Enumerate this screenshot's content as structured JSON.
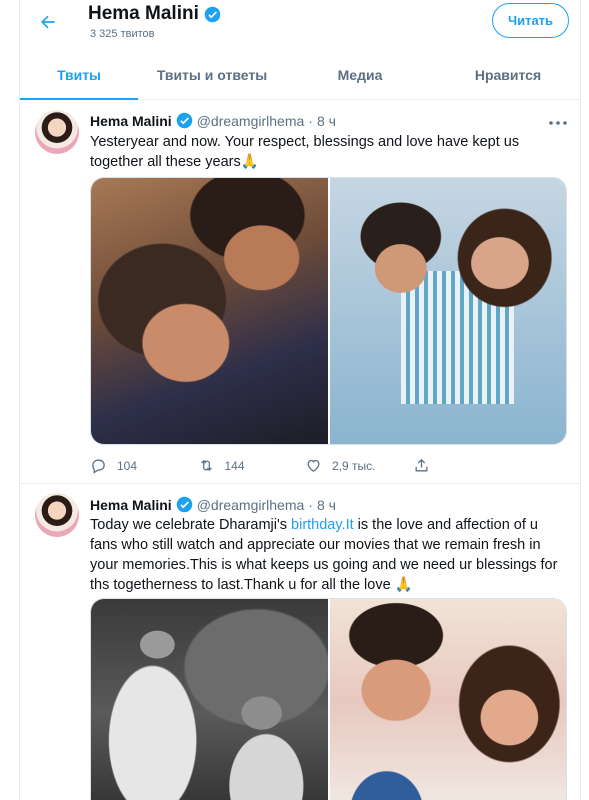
{
  "header": {
    "name": "Hema Malini",
    "tweet_count": "3 325 твитов",
    "follow_label": "Читать"
  },
  "tabs": [
    {
      "label": "Твиты",
      "active": true
    },
    {
      "label": "Твиты и ответы",
      "active": false
    },
    {
      "label": "Медиа",
      "active": false
    },
    {
      "label": "Нравится",
      "active": false
    }
  ],
  "tweets": [
    {
      "name": "Hema Malini",
      "handle": "@dreamgirlhema",
      "dot": "·",
      "time": "8 ч",
      "text": "Yesteryear and now. Your respect, blessings and love have kept us together all these years🙏",
      "replies": "104",
      "retweets": "144",
      "likes": "2,9 тыс."
    },
    {
      "name": "Hema Malini",
      "handle": "@dreamgirlhema",
      "dot": "·",
      "time": "8 ч",
      "text_before": "Today we celebrate Dharamji's ",
      "link": "birthday.It",
      "text_after": " is the love and affection of u fans who still watch and appreciate our movies that we remain fresh in your memories.This is what keeps us going and we need ur  blessings for ths togetherness to last.Thank u for all the love 🙏"
    }
  ],
  "colors": {
    "accent": "#1da1f2",
    "secondary_text": "#5b7083",
    "border": "#e6ecf0"
  }
}
